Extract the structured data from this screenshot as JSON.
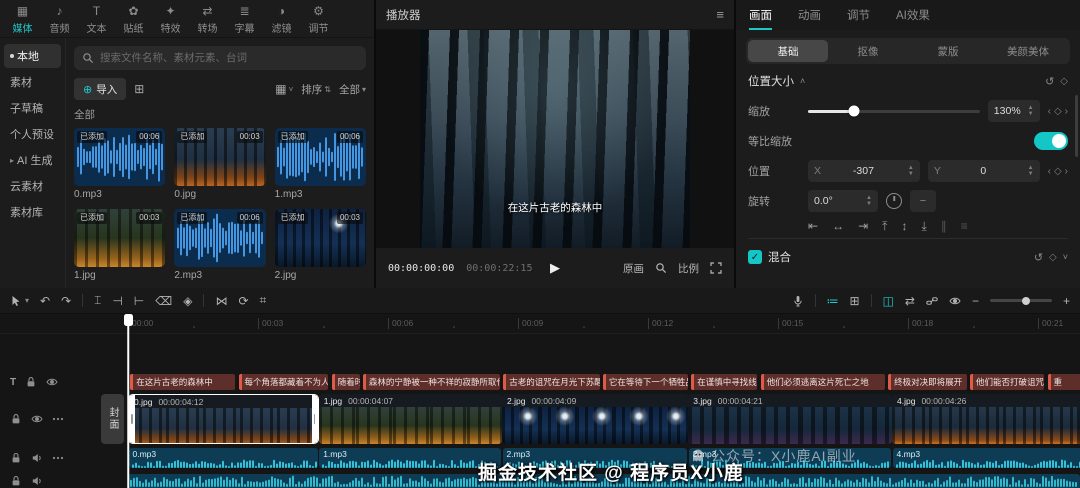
{
  "accent": "#1fc8c8",
  "ribbon_tabs": [
    {
      "id": "media",
      "label": "媒体",
      "glyph": "▦",
      "active": true
    },
    {
      "id": "audio",
      "label": "音频",
      "glyph": "♪"
    },
    {
      "id": "text",
      "label": "文本",
      "glyph": "T"
    },
    {
      "id": "sticker",
      "label": "贴纸",
      "glyph": "✿"
    },
    {
      "id": "effects",
      "label": "特效",
      "glyph": "✦"
    },
    {
      "id": "transitions",
      "label": "转场",
      "glyph": "⇄"
    },
    {
      "id": "captions",
      "label": "字幕",
      "glyph": "≣"
    },
    {
      "id": "filters",
      "label": "滤镜",
      "glyph": "◑"
    },
    {
      "id": "adjust",
      "label": "调节",
      "glyph": "⚙"
    }
  ],
  "sidebar_items": [
    {
      "id": "local",
      "label": "本地",
      "active": true
    },
    {
      "id": "materials",
      "label": "素材"
    },
    {
      "id": "sub-draft",
      "label": "子草稿"
    },
    {
      "id": "presets",
      "label": "个人预设"
    },
    {
      "id": "ai-generate",
      "label": "AI 生成",
      "expandable": true
    },
    {
      "id": "cloud",
      "label": "云素材"
    },
    {
      "id": "library",
      "label": "素材库"
    }
  ],
  "browser": {
    "search_placeholder": "搜索文件名称、素材元素、台词",
    "import_label": "导入",
    "sort_label": "排序",
    "filter_label": "全部",
    "section_label": "全部",
    "items": [
      {
        "name": "0.mp3",
        "type": "audio",
        "badge": "已添加",
        "duration": "00:06"
      },
      {
        "name": "0.jpg",
        "type": "image",
        "art": "art-f1",
        "badge": "已添加",
        "duration": "00:03"
      },
      {
        "name": "1.mp3",
        "type": "audio",
        "badge": "已添加",
        "duration": "00:06"
      },
      {
        "name": "1.jpg",
        "type": "image",
        "art": "art-f2",
        "badge": "已添加",
        "duration": "00:03"
      },
      {
        "name": "2.mp3",
        "type": "audio",
        "badge": "已添加",
        "duration": "00:06"
      },
      {
        "name": "2.jpg",
        "type": "image",
        "art": "art-f3",
        "badge": "已添加",
        "duration": "00:03"
      }
    ]
  },
  "player": {
    "title": "播放器",
    "subtitle": "在这片古老的森林中",
    "current_time": "00:00:00:00",
    "total_time": "00:00:22:15",
    "quality": "原画",
    "ratio": "比例"
  },
  "properties": {
    "tabs": [
      {
        "id": "picture",
        "label": "画面",
        "active": true
      },
      {
        "id": "animation",
        "label": "动画"
      },
      {
        "id": "adjust",
        "label": "调节"
      },
      {
        "id": "ai-effects",
        "label": "AI效果"
      }
    ],
    "subtabs": [
      {
        "id": "basic",
        "label": "基础",
        "active": true
      },
      {
        "id": "matting",
        "label": "抠像"
      },
      {
        "id": "mask",
        "label": "蒙版"
      },
      {
        "id": "beauty",
        "label": "美颜美体"
      }
    ],
    "position_size": {
      "title": "位置大小",
      "scale_label": "缩放",
      "scale_value": "130%",
      "scale_pct": 27,
      "uniform_label": "等比缩放",
      "uniform_on": true,
      "position_label": "位置",
      "x_label": "X",
      "x_value": "-307",
      "y_label": "Y",
      "y_value": "0",
      "rotate_label": "旋转",
      "rotate_value": "0.0°"
    },
    "align_icons": [
      {
        "name": "align-left",
        "glyph": "⇤"
      },
      {
        "name": "align-center-horizontal",
        "glyph": "↔"
      },
      {
        "name": "align-right",
        "glyph": "⇥"
      },
      {
        "name": "align-top",
        "glyph": "⤒"
      },
      {
        "name": "align-middle-vertical",
        "glyph": "↕"
      },
      {
        "name": "align-bottom",
        "glyph": "⤓"
      },
      {
        "name": "distribute-horizontal",
        "glyph": "∥",
        "dim": true
      },
      {
        "name": "distribute-vertical",
        "glyph": "≡",
        "dim": true
      }
    ],
    "blend_title": "混合"
  },
  "timeline": {
    "tools_left": [
      {
        "name": "select-tool",
        "svg": "cursor"
      },
      {
        "name": "select-tool-dropdown",
        "glyph": "▾",
        "small": true
      },
      {
        "name": "undo",
        "glyph": "↶"
      },
      {
        "name": "redo",
        "glyph": "↷"
      },
      {
        "sep": true
      },
      {
        "name": "split",
        "glyph": "⌶"
      },
      {
        "name": "trim-left",
        "glyph": "⊣"
      },
      {
        "name": "trim-right",
        "glyph": "⊢"
      },
      {
        "name": "delete",
        "glyph": "⌫"
      },
      {
        "name": "mask",
        "glyph": "◈"
      },
      {
        "sep": true
      },
      {
        "name": "mirror",
        "glyph": "⋈"
      },
      {
        "name": "rotate",
        "glyph": "⟳"
      },
      {
        "name": "crop",
        "glyph": "⌗"
      }
    ],
    "tools_right": [
      {
        "name": "record-audio",
        "svg": "mic"
      },
      {
        "sep": true
      },
      {
        "name": "auto-captions",
        "glyph": "≔",
        "teal": true
      },
      {
        "name": "smart-tools",
        "glyph": "⊞"
      },
      {
        "sep": true
      },
      {
        "name": "main-track-magnet",
        "glyph": "◫",
        "teal": true
      },
      {
        "name": "auto-snap",
        "glyph": "⇄"
      },
      {
        "name": "linkage",
        "svg": "link"
      },
      {
        "name": "preview-axis",
        "svg": "eye"
      },
      {
        "name": "timeline-zoom-out",
        "glyph": "−"
      },
      {
        "slider": true
      },
      {
        "name": "timeline-zoom-in",
        "glyph": "+"
      }
    ],
    "ruler": [
      "00:00",
      "00:03",
      "00:06",
      "00:09",
      "00:12",
      "00:15",
      "00:18",
      "00:21"
    ],
    "cover_label": "封面",
    "text_clips": [
      {
        "label": "在这片古老的森林中",
        "start": 0.05,
        "dur": 2.45
      },
      {
        "label": "每个角落都藏着不为人知的秘密",
        "start": 2.55,
        "dur": 2.1
      },
      {
        "label": "随着时间",
        "start": 4.7,
        "dur": 0.68
      },
      {
        "label": "森林的宁静被一种不祥的寂静所取代",
        "start": 5.42,
        "dur": 3.2
      },
      {
        "label": "古老的诅咒在月光下苏醒",
        "start": 8.66,
        "dur": 2.26
      },
      {
        "label": "它在等待下一个牺牲品",
        "start": 10.96,
        "dur": 2.0
      },
      {
        "label": "在谨慎中寻找线索",
        "start": 13.0,
        "dur": 1.55
      },
      {
        "label": "他们必须逃离这片死亡之地",
        "start": 14.6,
        "dur": 2.9
      },
      {
        "label": "终极对决即将展开",
        "start": 17.54,
        "dur": 1.85
      },
      {
        "label": "他们能否打破诅咒",
        "start": 19.43,
        "dur": 1.75
      },
      {
        "label": "重",
        "start": 21.22,
        "dur": 1.3
      }
    ],
    "video_clips": [
      {
        "name": "0.jpg",
        "duration": "00:00:04:12",
        "seconds": 4.4,
        "art": "art-f1",
        "selected": true
      },
      {
        "name": "1.jpg",
        "duration": "00:00:04:07",
        "seconds": 4.23,
        "art": "art-f2"
      },
      {
        "name": "2.jpg",
        "duration": "00:00:04:09",
        "seconds": 4.3,
        "art": "art-f3"
      },
      {
        "name": "3.jpg",
        "duration": "00:00:04:21",
        "seconds": 4.7,
        "art": "art-f4"
      },
      {
        "name": "4.jpg",
        "duration": "00:00:04:26",
        "seconds": 4.87,
        "art": "art-f5"
      }
    ],
    "audio_clips": [
      {
        "name": "0.mp3",
        "seconds": 4.4
      },
      {
        "name": "1.mp3",
        "seconds": 4.23
      },
      {
        "name": "2.mp3",
        "seconds": 4.3
      },
      {
        "name": "3.mp3",
        "seconds": 4.7
      },
      {
        "name": "4.mp3",
        "seconds": 4.87
      }
    ]
  },
  "watermarks": {
    "small": "公众号：X小鹿AI副业",
    "large": "掘金技术社区 @ 程序员X小鹿"
  }
}
